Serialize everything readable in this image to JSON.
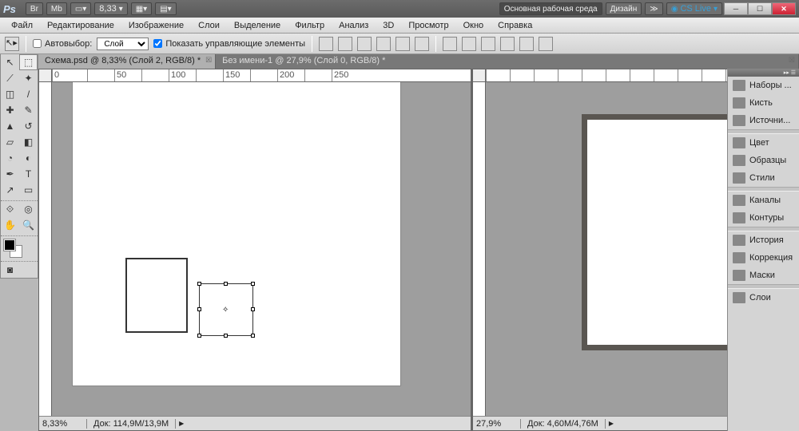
{
  "title": {
    "ps": "Ps",
    "br": "Br",
    "mb": "Mb",
    "zoom": "8,33",
    "workspace_main": "Основная рабочая среда",
    "workspace_design": "Дизайн",
    "cslive": "CS Live"
  },
  "menu": [
    "Файл",
    "Редактирование",
    "Изображение",
    "Слои",
    "Выделение",
    "Фильтр",
    "Анализ",
    "3D",
    "Просмотр",
    "Окно",
    "Справка"
  ],
  "options": {
    "autoselect": "Автовыбор:",
    "layer": "Слой",
    "show_controls": "Показать управляющие элементы"
  },
  "tabs": {
    "tab1": "Схема.psd @ 8,33% (Слой 2, RGB/8) *",
    "tab2": "Без имени-1 @ 27,9% (Слой 0, RGB/8) *"
  },
  "status": {
    "zoom1": "8,33%",
    "doc1": "Док: 114,9M/13,9M",
    "zoom2": "27,9%",
    "doc2": "Док: 4,60M/4,76M"
  },
  "panels": [
    "Наборы ...",
    "Кисть",
    "Источни...",
    "Цвет",
    "Образцы",
    "Стили",
    "Каналы",
    "Контуры",
    "История",
    "Коррекция",
    "Маски",
    "Слои"
  ],
  "ruler_ticks": [
    "0",
    "50",
    "100",
    "150",
    "200",
    "250"
  ]
}
